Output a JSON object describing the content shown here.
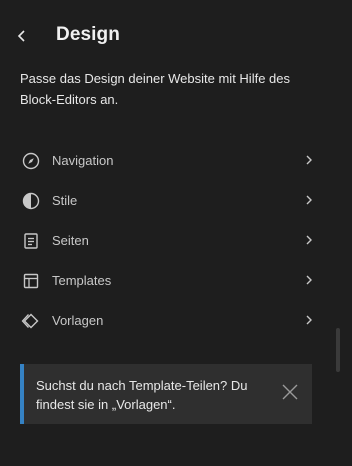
{
  "header": {
    "title": "Design",
    "back_icon": "chevron-left-icon"
  },
  "description": "Passe das Design deiner Website mit Hilfe des Block-Editors an.",
  "nav": {
    "items": [
      {
        "label": "Navigation",
        "icon": "compass-icon"
      },
      {
        "label": "Stile",
        "icon": "half-circle-icon"
      },
      {
        "label": "Seiten",
        "icon": "page-icon"
      },
      {
        "label": "Templates",
        "icon": "layout-icon"
      },
      {
        "label": "Vorlagen",
        "icon": "diamond-icon"
      }
    ]
  },
  "notice": {
    "text": "Suchst du nach Template-Teilen? Du findest sie in „Vorlagen“.",
    "accent_color": "#3582c4"
  },
  "colors": {
    "background": "#1e1e1e",
    "notice_background": "#2f2f2f"
  }
}
